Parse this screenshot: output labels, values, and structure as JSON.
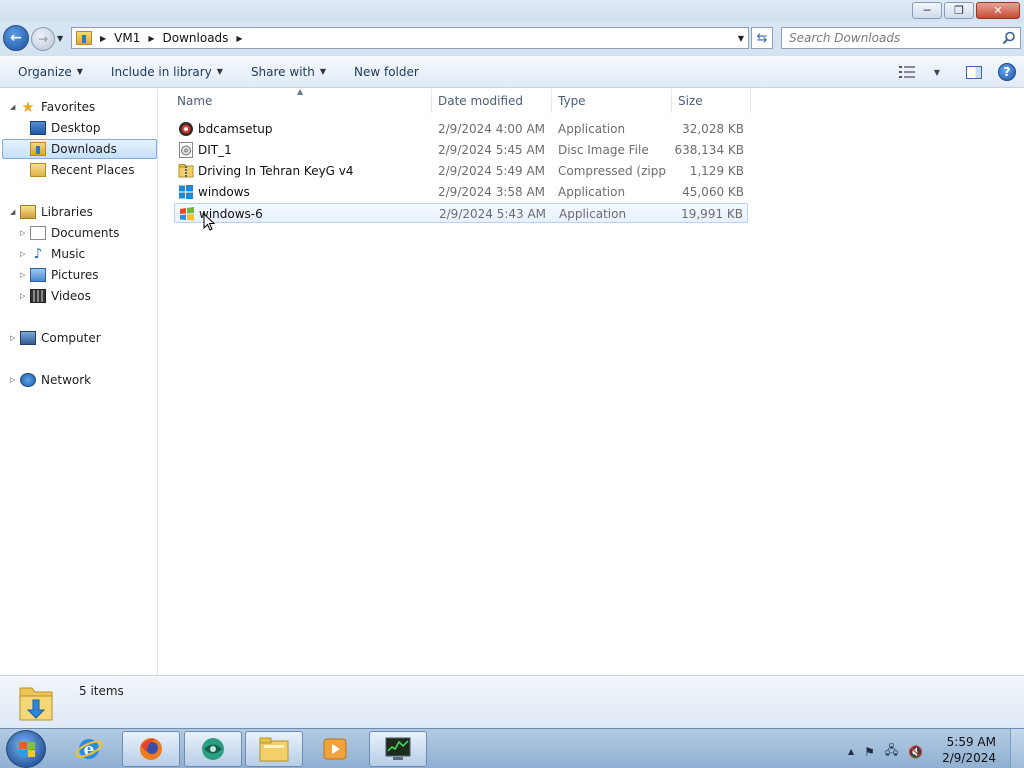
{
  "window": {
    "minimize_glyph": "─",
    "maximize_glyph": "❐",
    "close_glyph": "✕"
  },
  "navbar": {
    "breadcrumbs": [
      "VM1",
      "Downloads"
    ],
    "search_placeholder": "Search Downloads"
  },
  "commandbar": {
    "organize": "Organize",
    "include_in_library": "Include in library",
    "share_with": "Share with",
    "new_folder": "New folder"
  },
  "navpane": {
    "favorites": "Favorites",
    "desktop": "Desktop",
    "downloads": "Downloads",
    "recent_places": "Recent Places",
    "libraries": "Libraries",
    "documents": "Documents",
    "music": "Music",
    "pictures": "Pictures",
    "videos": "Videos",
    "computer": "Computer",
    "network": "Network"
  },
  "columns": {
    "name": "Name",
    "date_modified": "Date modified",
    "type": "Type",
    "size": "Size"
  },
  "files": [
    {
      "name": "bdcamsetup",
      "date": "2/9/2024 4:00 AM",
      "type": "Application",
      "size": "32,028 KB",
      "icon": "bandicam-icon"
    },
    {
      "name": "DIT_1",
      "date": "2/9/2024 5:45 AM",
      "type": "Disc Image File",
      "size": "638,134 KB",
      "icon": "disc-image-icon"
    },
    {
      "name": "Driving In Tehran KeyG v4",
      "date": "2/9/2024 5:49 AM",
      "type": "Compressed (zipp...",
      "size": "1,129 KB",
      "icon": "zip-folder-icon"
    },
    {
      "name": "windows",
      "date": "2/9/2024 3:58 AM",
      "type": "Application",
      "size": "45,060 KB",
      "icon": "windows-logo-icon"
    },
    {
      "name": "windows-6",
      "date": "2/9/2024 5:43 AM",
      "type": "Application",
      "size": "19,991 KB",
      "icon": "windows-flag-icon"
    }
  ],
  "details": {
    "item_count": "5 items"
  },
  "taskbar": {
    "time": "5:59 AM",
    "date": "2/9/2024"
  },
  "colors": {
    "selection_border": "#84acdd",
    "link_text": "#1e395b",
    "taskbar": "#9ebad8"
  }
}
